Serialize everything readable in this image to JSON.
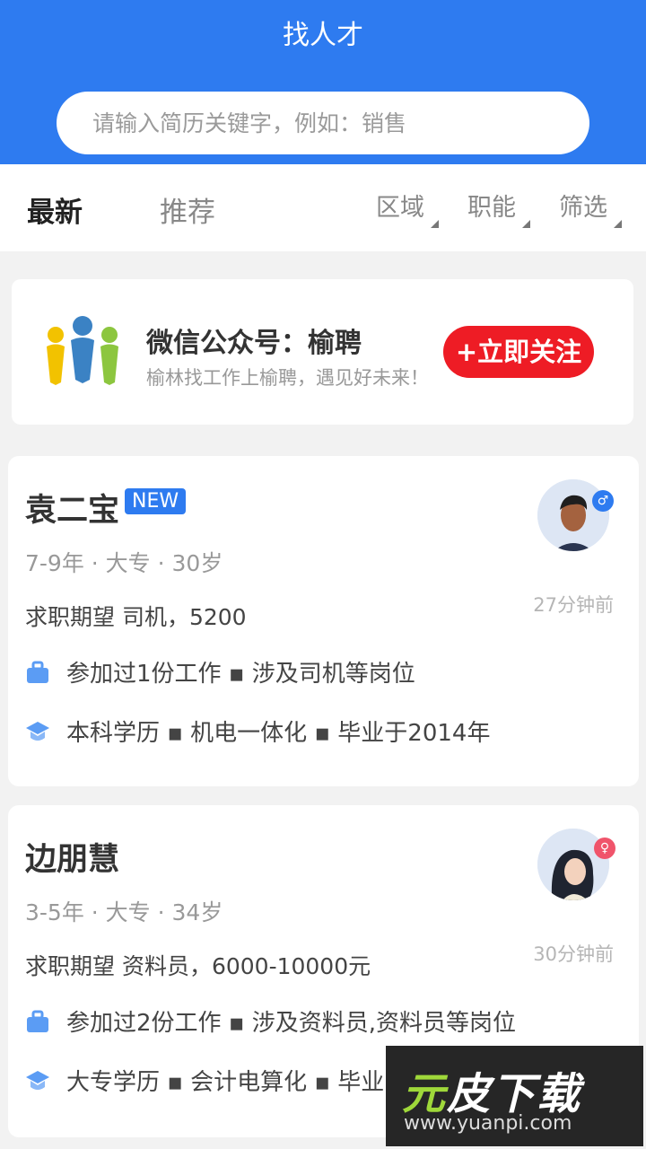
{
  "header": {
    "title": "找人才"
  },
  "search": {
    "placeholder": "请输入简历关键字，例如：销售"
  },
  "tabs": {
    "latest": "最新",
    "recommend": "推荐"
  },
  "filters": {
    "area": "区域",
    "function": "职能",
    "screen": "筛选"
  },
  "banner": {
    "title": "微信公众号：榆聘",
    "subtitle": "榆林找工作上榆聘，遇见好未来！",
    "button": "+立即关注"
  },
  "candidates": [
    {
      "name": "袁二宝",
      "badge": "NEW",
      "meta": "7-9年 · 大专 · 30岁",
      "expect": "求职期望 司机，5200",
      "work": "参加过1份工作 ▪ 涉及司机等岗位",
      "edu": "本科学历 ▪ 机电一体化 ▪ 毕业于2014年",
      "time": "27分钟前",
      "gender": "male"
    },
    {
      "name": "边朋慧",
      "meta": "3-5年 · 大专 · 34岁",
      "expect": "求职期望 资料员，6000-10000元",
      "work": "参加过2份工作 ▪ 涉及资料员,资料员等岗位",
      "edu": "大专学历 ▪ 会计电算化 ▪ 毕业",
      "time": "30分钟前",
      "gender": "female"
    }
  ],
  "watermark": {
    "logo_a": "元",
    "logo_b": "皮下载",
    "url": "www.yuanpi.com"
  },
  "colors": {
    "brand": "#2e7bf0",
    "follow": "#ee1c25",
    "icon": "#5b9cf4"
  }
}
